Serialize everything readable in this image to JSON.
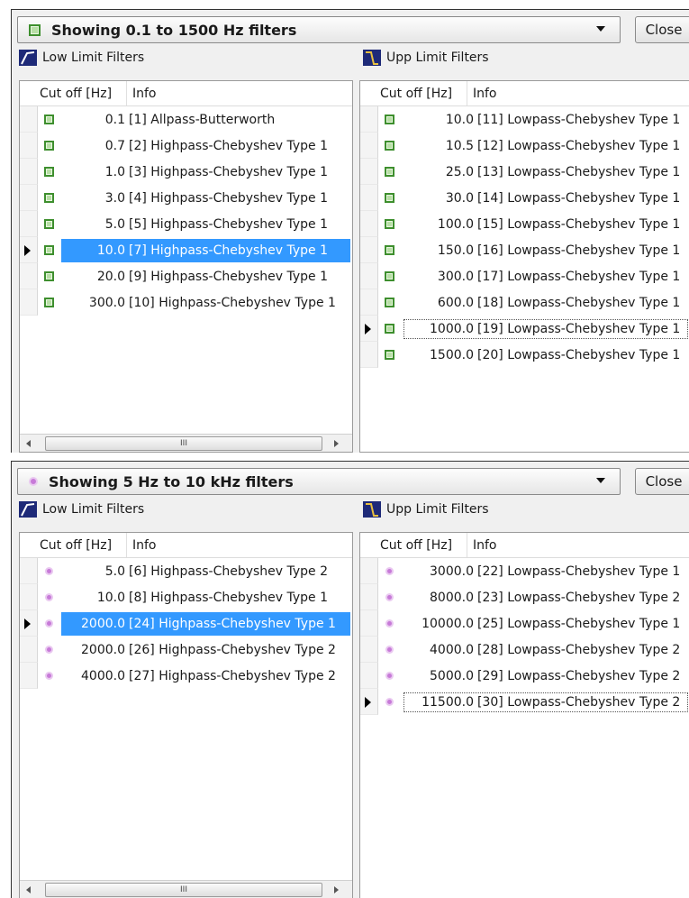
{
  "panels": [
    {
      "combo_text": "Showing 0.1 to 1500 Hz filters",
      "close_label": "Close",
      "marker": "green-square",
      "low_label": "Low Limit Filters",
      "upp_label": "Upp Limit Filters",
      "col_cut": "Cut off [Hz]",
      "col_info": "Info",
      "scroll_grip": "III",
      "low_rows": [
        {
          "cut": "0.1",
          "info": "[1] Allpass-Butterworth"
        },
        {
          "cut": "0.7",
          "info": "[2] Highpass-Chebyshev Type 1"
        },
        {
          "cut": "1.0",
          "info": "[3] Highpass-Chebyshev Type 1"
        },
        {
          "cut": "3.0",
          "info": "[4] Highpass-Chebyshev Type 1"
        },
        {
          "cut": "5.0",
          "info": "[5] Highpass-Chebyshev Type 1"
        },
        {
          "cut": "10.0",
          "info": "[7] Highpass-Chebyshev Type 1"
        },
        {
          "cut": "20.0",
          "info": "[9] Highpass-Chebyshev Type 1"
        },
        {
          "cut": "300.0",
          "info": "[10] Highpass-Chebyshev Type 1"
        }
      ],
      "upp_rows": [
        {
          "cut": "10.0",
          "info": "[11] Lowpass-Chebyshev Type 1"
        },
        {
          "cut": "10.5",
          "info": "[12] Lowpass-Chebyshev Type 1"
        },
        {
          "cut": "25.0",
          "info": "[13] Lowpass-Chebyshev Type 1"
        },
        {
          "cut": "30.0",
          "info": "[14] Lowpass-Chebyshev Type 1"
        },
        {
          "cut": "100.0",
          "info": "[15] Lowpass-Chebyshev Type 1"
        },
        {
          "cut": "150.0",
          "info": "[16] Lowpass-Chebyshev Type 1"
        },
        {
          "cut": "300.0",
          "info": "[17] Lowpass-Chebyshev Type 1"
        },
        {
          "cut": "600.0",
          "info": "[18] Lowpass-Chebyshev Type 1"
        },
        {
          "cut": "1000.0",
          "info": "[19] Lowpass-Chebyshev Type 1"
        },
        {
          "cut": "1500.0",
          "info": "[20] Lowpass-Chebyshev Type 1"
        }
      ]
    },
    {
      "combo_text": "Showing 5 Hz to 10 kHz filters",
      "close_label": "Close",
      "marker": "pink-dot",
      "low_label": "Low Limit Filters",
      "upp_label": "Upp Limit Filters",
      "col_cut": "Cut off [Hz]",
      "col_info": "Info",
      "scroll_grip": "III",
      "low_rows": [
        {
          "cut": "5.0",
          "info": "[6] Highpass-Chebyshev Type 2"
        },
        {
          "cut": "10.0",
          "info": "[8] Highpass-Chebyshev Type 1"
        },
        {
          "cut": "2000.0",
          "info": "[24] Highpass-Chebyshev Type 1"
        },
        {
          "cut": "2000.0",
          "info": "[26] Highpass-Chebyshev Type 2"
        },
        {
          "cut": "4000.0",
          "info": "[27] Highpass-Chebyshev Type 2"
        }
      ],
      "upp_rows": [
        {
          "cut": "3000.0",
          "info": "[22] Lowpass-Chebyshev Type 1"
        },
        {
          "cut": "8000.0",
          "info": "[23] Lowpass-Chebyshev Type 2"
        },
        {
          "cut": "10000.0",
          "info": "[25] Lowpass-Chebyshev Type 1"
        },
        {
          "cut": "4000.0",
          "info": "[28] Lowpass-Chebyshev Type 2"
        },
        {
          "cut": "5000.0",
          "info": "[29] Lowpass-Chebyshev Type 2"
        },
        {
          "cut": "11500.0",
          "info": "[30] Lowpass-Chebyshev Type 2"
        }
      ]
    }
  ],
  "colors": {
    "selection": "#3399ff",
    "green_marker": "#3e8f2e",
    "pink_marker": "#c77ad8",
    "highpass_icon": "#1e1e6e",
    "lowpass_icon": "#1e1e6e"
  },
  "icons": {
    "low_limit": "highpass-filter-icon",
    "upp_limit": "lowpass-filter-icon",
    "current_row": "row-pointer-icon"
  }
}
